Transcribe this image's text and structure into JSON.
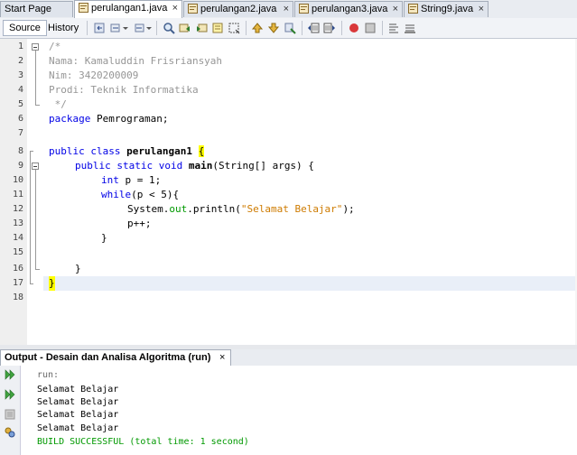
{
  "tabs": [
    {
      "label": "Start Page",
      "active": false
    },
    {
      "label": "perulangan1.java",
      "active": true
    },
    {
      "label": "perulangan2.java",
      "active": false
    },
    {
      "label": "perulangan3.java",
      "active": false
    },
    {
      "label": "String9.java",
      "active": false
    }
  ],
  "close_glyph": "×",
  "toolbar": {
    "source_label": "Source",
    "history_label": "History"
  },
  "line_numbers": [
    "1",
    "2",
    "3",
    "4",
    "5",
    "6",
    "7",
    "8",
    "9",
    "10",
    "11",
    "12",
    "13",
    "14",
    "15",
    "16",
    "17",
    "18"
  ],
  "code": {
    "l1": "/*",
    "l2": "Nama: Kamaluddin Frisriansyah",
    "l3": "Nim: 3420200009",
    "l4": "Prodi: Teknik Informatika",
    "l5": " */",
    "l6_kw": "package",
    "l6_rest": " Pemrograman;",
    "l8_kw": "public class",
    "l8_name": " perulangan1 ",
    "l8_brace": "{",
    "l9_kw": "public static void",
    "l9_name": " main",
    "l9_rest": "(String[] args) {",
    "l10_kw": "int",
    "l10_rest": " p = 1;",
    "l11_kw": "while",
    "l11_rest": "(p < 5){",
    "l12_a": "System.",
    "l12_field": "out",
    "l12_b": ".println(",
    "l12_str": "\"Selamat Belajar\"",
    "l12_c": ");",
    "l13": "p++;",
    "l14": "}",
    "l16": "}",
    "l17": "}"
  },
  "output": {
    "tab_title": "Output - Desain dan Analisa Algoritma (run)",
    "lines": [
      "run:",
      "Selamat Belajar",
      "Selamat Belajar",
      "Selamat Belajar",
      "Selamat Belajar",
      "BUILD SUCCESSFUL (total time: 1 second)"
    ]
  },
  "colors": {
    "keyword": "#0000e6",
    "comment": "#969696",
    "string": "#ce7b00",
    "field": "#009900",
    "success": "#009900",
    "highlight": "#ffff00"
  }
}
